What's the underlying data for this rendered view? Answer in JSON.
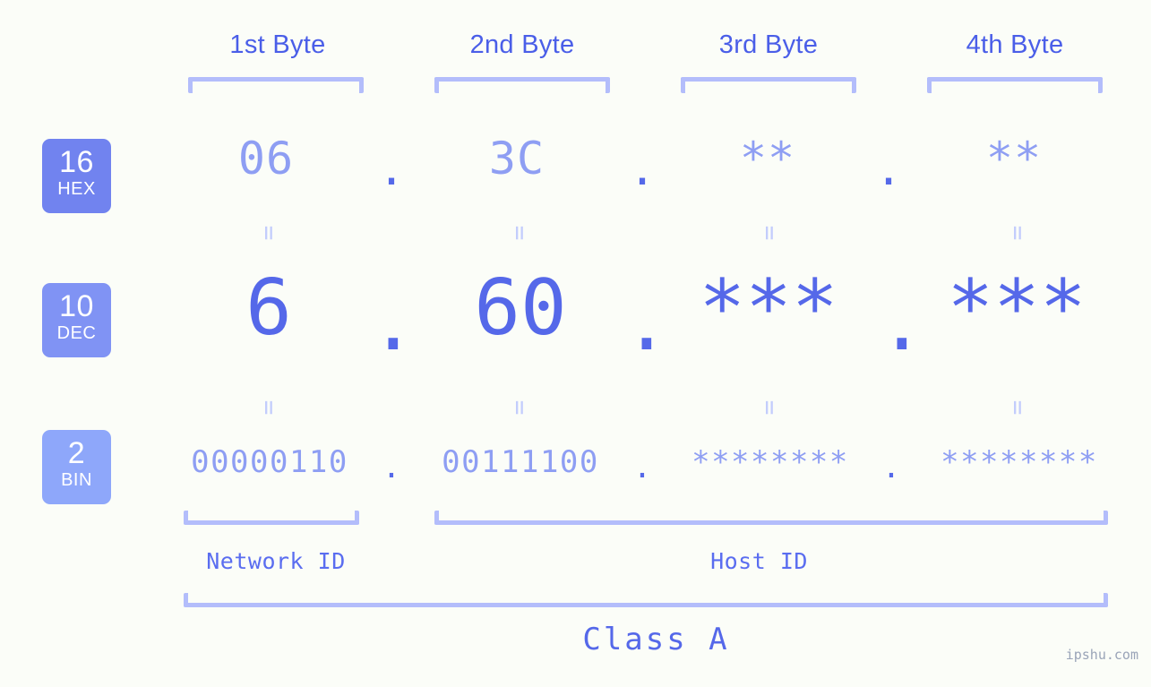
{
  "page": {
    "background": "#fbfdf8",
    "watermark": "ipshu.com"
  },
  "colors": {
    "header_text": "#4a5ee8",
    "bracket": "#b3bdfb",
    "badge_hex": "#7183ef",
    "badge_dec": "#8093f4",
    "badge_bin": "#8ea7fa",
    "value_light": "#8e9ef3",
    "value_strong": "#5568e9",
    "equals": "#c3cdfc",
    "watermark": "#9aa4b8"
  },
  "byte_headers": [
    {
      "label": "1st Byte"
    },
    {
      "label": "2nd Byte"
    },
    {
      "label": "3rd Byte"
    },
    {
      "label": "4th Byte"
    }
  ],
  "rows": [
    {
      "key": "hex",
      "badge_number": "16",
      "badge_name": "HEX",
      "values": [
        "06",
        "3C",
        "**",
        "**"
      ],
      "separator": "."
    },
    {
      "key": "dec",
      "badge_number": "10",
      "badge_name": "DEC",
      "values": [
        "6",
        "60",
        "***",
        "***"
      ],
      "separator": "."
    },
    {
      "key": "bin",
      "badge_number": "2",
      "badge_name": "BIN",
      "values": [
        "00000110",
        "00111100",
        "********",
        "********"
      ],
      "separator": "."
    }
  ],
  "equals_glyph": "=",
  "footer": {
    "network_id": "Network ID",
    "host_id": "Host ID",
    "class": "Class A"
  }
}
